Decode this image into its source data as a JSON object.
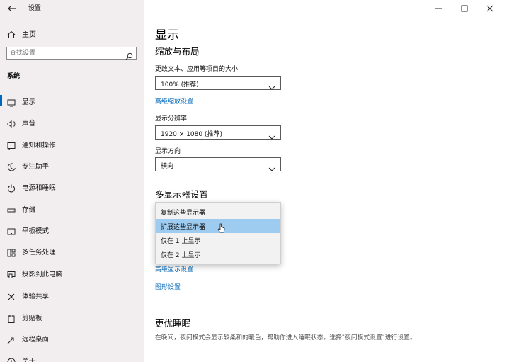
{
  "window": {
    "title": "设置",
    "controls": {
      "minimize": "minimize-icon",
      "maximize": "maximize-icon",
      "close": "close-icon"
    }
  },
  "sidebar": {
    "home_label": "主页",
    "search_placeholder": "查找设置",
    "section_label": "系统",
    "items": [
      {
        "label": "显示",
        "icon": "monitor-icon",
        "active": true
      },
      {
        "label": "声音",
        "icon": "speaker-icon"
      },
      {
        "label": "通知和操作",
        "icon": "notification-icon"
      },
      {
        "label": "专注助手",
        "icon": "moon-icon"
      },
      {
        "label": "电源和睡眠",
        "icon": "power-icon"
      },
      {
        "label": "存储",
        "icon": "storage-icon"
      },
      {
        "label": "平板模式",
        "icon": "tablet-icon"
      },
      {
        "label": "多任务处理",
        "icon": "multitask-icon"
      },
      {
        "label": "投影到此电脑",
        "icon": "project-icon"
      },
      {
        "label": "体验共享",
        "icon": "share-icon"
      },
      {
        "label": "剪贴板",
        "icon": "clipboard-icon"
      },
      {
        "label": "远程桌面",
        "icon": "remote-icon"
      },
      {
        "label": "关于",
        "icon": "info-icon"
      }
    ]
  },
  "main": {
    "title": "显示",
    "scale_section": "缩放与布局",
    "scale_label": "更改文本、应用等项目的大小",
    "scale_value": "100% (推荐)",
    "advanced_scaling_link": "高级缩放设置",
    "resolution_label": "显示分辨率",
    "resolution_value": "1920 × 1080 (推荐)",
    "orientation_label": "显示方向",
    "orientation_value": "横向",
    "multi_display_section": "多显示器设置",
    "multi_display_options": [
      "复制这些显示器",
      "扩展这些显示器",
      "仅在 1 上显示",
      "仅在 2 上显示"
    ],
    "multi_display_selected_index": 1,
    "advanced_display_link": "高级显示设置",
    "graphics_link": "图形设置",
    "sleep_section": "更优睡眠",
    "sleep_description": "在晚间，夜间模式会显示较柔和的暖色，帮助你进入睡眠状态。选择\"夜间模式设置\"进行设置。"
  },
  "colors": {
    "accent": "#0067c0",
    "link": "#0067b8",
    "selection": "#9ecbf0",
    "sidebar_bg": "#f2eef0"
  }
}
